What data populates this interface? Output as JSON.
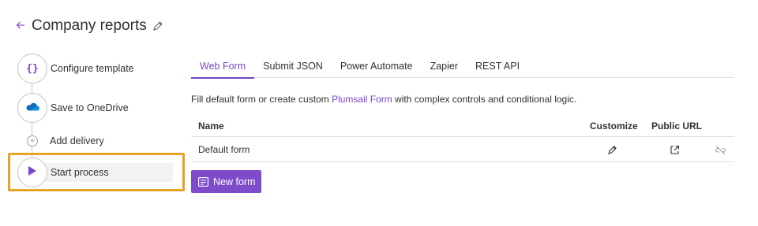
{
  "header": {
    "title": "Company reports"
  },
  "steps": [
    {
      "label": "Configure template",
      "icon": "curly-braces-icon"
    },
    {
      "label": "Save to OneDrive",
      "icon": "onedrive-icon"
    },
    {
      "label": "Add delivery",
      "icon": "plus-icon"
    },
    {
      "label": "Start process",
      "icon": "play-icon"
    }
  ],
  "tabs": [
    {
      "label": "Web Form",
      "active": true
    },
    {
      "label": "Submit JSON"
    },
    {
      "label": "Power Automate"
    },
    {
      "label": "Zapier"
    },
    {
      "label": "REST API"
    }
  ],
  "description": {
    "before": "Fill default form or create custom ",
    "link": "Plumsail Form",
    "after": " with complex controls and conditional logic."
  },
  "table": {
    "headers": {
      "name": "Name",
      "customize": "Customize",
      "public_url": "Public URL"
    },
    "rows": [
      {
        "name": "Default form"
      }
    ]
  },
  "new_form_button": {
    "label": "New form"
  },
  "colors": {
    "accent": "#7e4ccb",
    "highlight": "#e6a324",
    "onedrive": "#0f6cbd"
  }
}
